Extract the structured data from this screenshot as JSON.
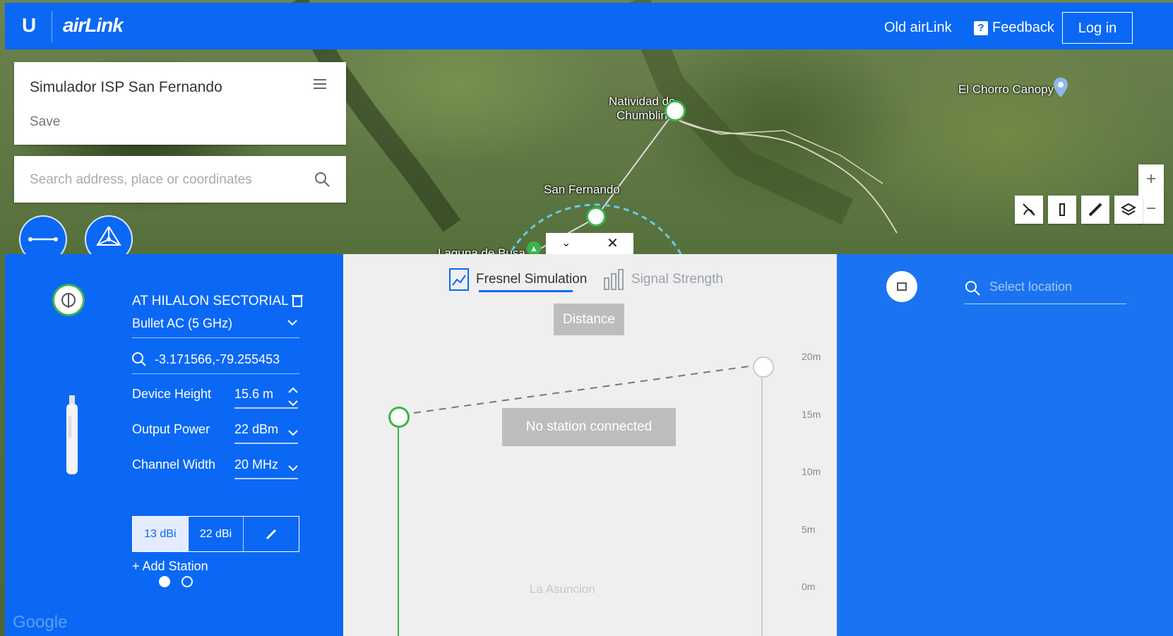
{
  "topbar": {
    "brand_logo": "U",
    "brand_name": "airLink",
    "old_airlink": "Old airLink",
    "feedback": "Feedback",
    "feedback_icon": "?",
    "login": "Log in"
  },
  "project": {
    "title": "Simulador ISP San Fernando",
    "save": "Save"
  },
  "search": {
    "placeholder": "Search address, place or coordinates"
  },
  "map": {
    "labels": {
      "natividad_1": "Natividad de",
      "natividad_2": "Chumblin",
      "san_fernando": "San Fernando",
      "laguna": "Laguna de Busa",
      "el_chorro": "El Chorro Canopy",
      "la_asuncion": "La Asuncion",
      "google": "Google"
    },
    "zoom": {
      "in": "+",
      "out": "−"
    }
  },
  "panel": {
    "handle": {
      "collapse": "⌄",
      "close": "✕"
    },
    "device": {
      "name": "AT HILALON SECTORIAL",
      "model": "Bullet AC (5 GHz)",
      "coords": "-3.171566,-79.255453",
      "height_label": "Device Height",
      "height_value": "15.6 m",
      "power_label": "Output Power",
      "power_value": "22 dBm",
      "width_label": "Channel Width",
      "width_value": "20 MHz",
      "gain_options": [
        "13 dBi",
        "22 dBi"
      ],
      "add_station": "+ Add Station"
    },
    "tabs": {
      "fresnel": "Fresnel Simulation",
      "signal": "Signal Strength"
    },
    "distance": "Distance",
    "no_station": "No station connected",
    "y_ticks": [
      "20m",
      "15m",
      "10m",
      "5m",
      "0m"
    ],
    "select_location": "Select location"
  },
  "colors": {
    "accent": "#0a68f5",
    "station_green": "#3ab54a"
  }
}
